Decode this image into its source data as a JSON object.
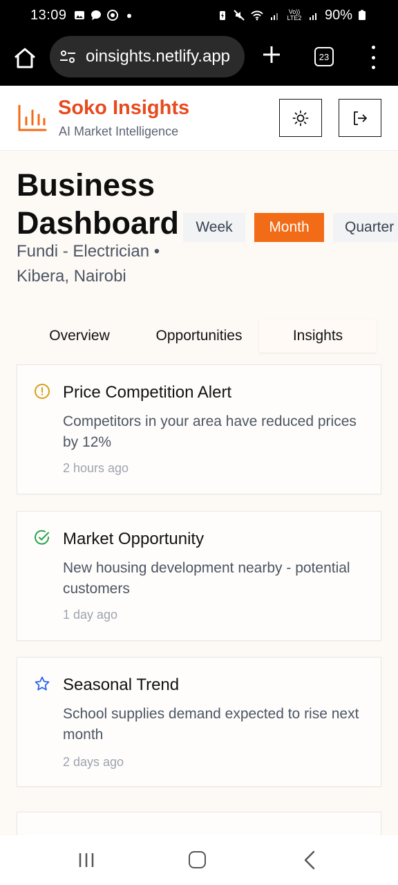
{
  "status_bar": {
    "time": "13:09",
    "battery": "90%",
    "network": "Vo)) LTE2"
  },
  "browser": {
    "url": "oinsights.netlify.app",
    "tab_count": "23"
  },
  "app": {
    "brand_title": "Soko Insights",
    "brand_subtitle": "AI Market Intelligence",
    "brand_color": "#e8491d"
  },
  "dashboard": {
    "title_line1": "Business",
    "title_line2": "Dashboard",
    "subtitle_line1": "Fundi - Electrician •",
    "subtitle_line2": "Kibera, Nairobi",
    "periods": [
      "Week",
      "Month",
      "Quarter"
    ],
    "selected_period": "Month",
    "accent_color": "#f26b16"
  },
  "tabs": [
    "Overview",
    "Opportunities",
    "Insights"
  ],
  "selected_tab": "Insights",
  "insights": [
    {
      "icon": "alert-circle-icon",
      "icon_color": "#d4a017",
      "title": "Price Competition Alert",
      "description": "Competitors in your area have reduced prices by 12%",
      "time": "2 hours ago"
    },
    {
      "icon": "check-circle-icon",
      "icon_color": "#22a34a",
      "title": "Market Opportunity",
      "description": "New housing development nearby - potential customers",
      "time": "1 day ago"
    },
    {
      "icon": "star-icon",
      "icon_color": "#2563eb",
      "title": "Seasonal Trend",
      "description": "School supplies demand expected to rise next month",
      "time": "2 days ago"
    }
  ]
}
